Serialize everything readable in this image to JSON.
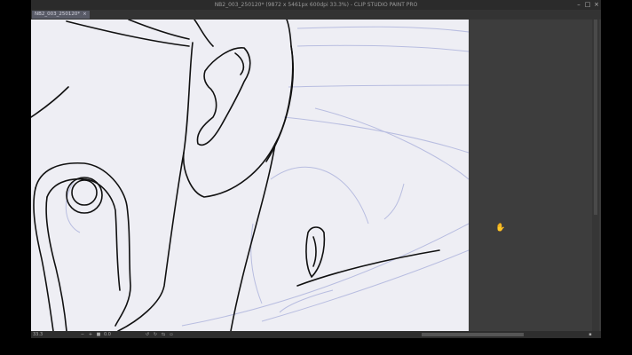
{
  "window": {
    "title": "NB2_003_250120* (9872 x 5461px 600dpi 33.3%) - CLIP STUDIO PAINT PRO",
    "min_label": "–",
    "max_label": "□",
    "close_label": "×"
  },
  "tabs": [
    {
      "label": "NB2_003_250120*",
      "close": "×"
    }
  ],
  "statusbar": {
    "zoom": "33.3",
    "angle": "0.0"
  },
  "icons": {
    "minimize": "minimize-icon",
    "maximize": "maximize-icon",
    "close": "close-icon",
    "cursor": "hand-cursor-icon"
  },
  "colors": {
    "canvas": "#eeeef4",
    "workspace": "#3d3d3d",
    "titlebar": "#2b2b2b",
    "active_tab": "#585a66",
    "line_art": "#111111",
    "sketch_lines": "#b8bde0"
  }
}
